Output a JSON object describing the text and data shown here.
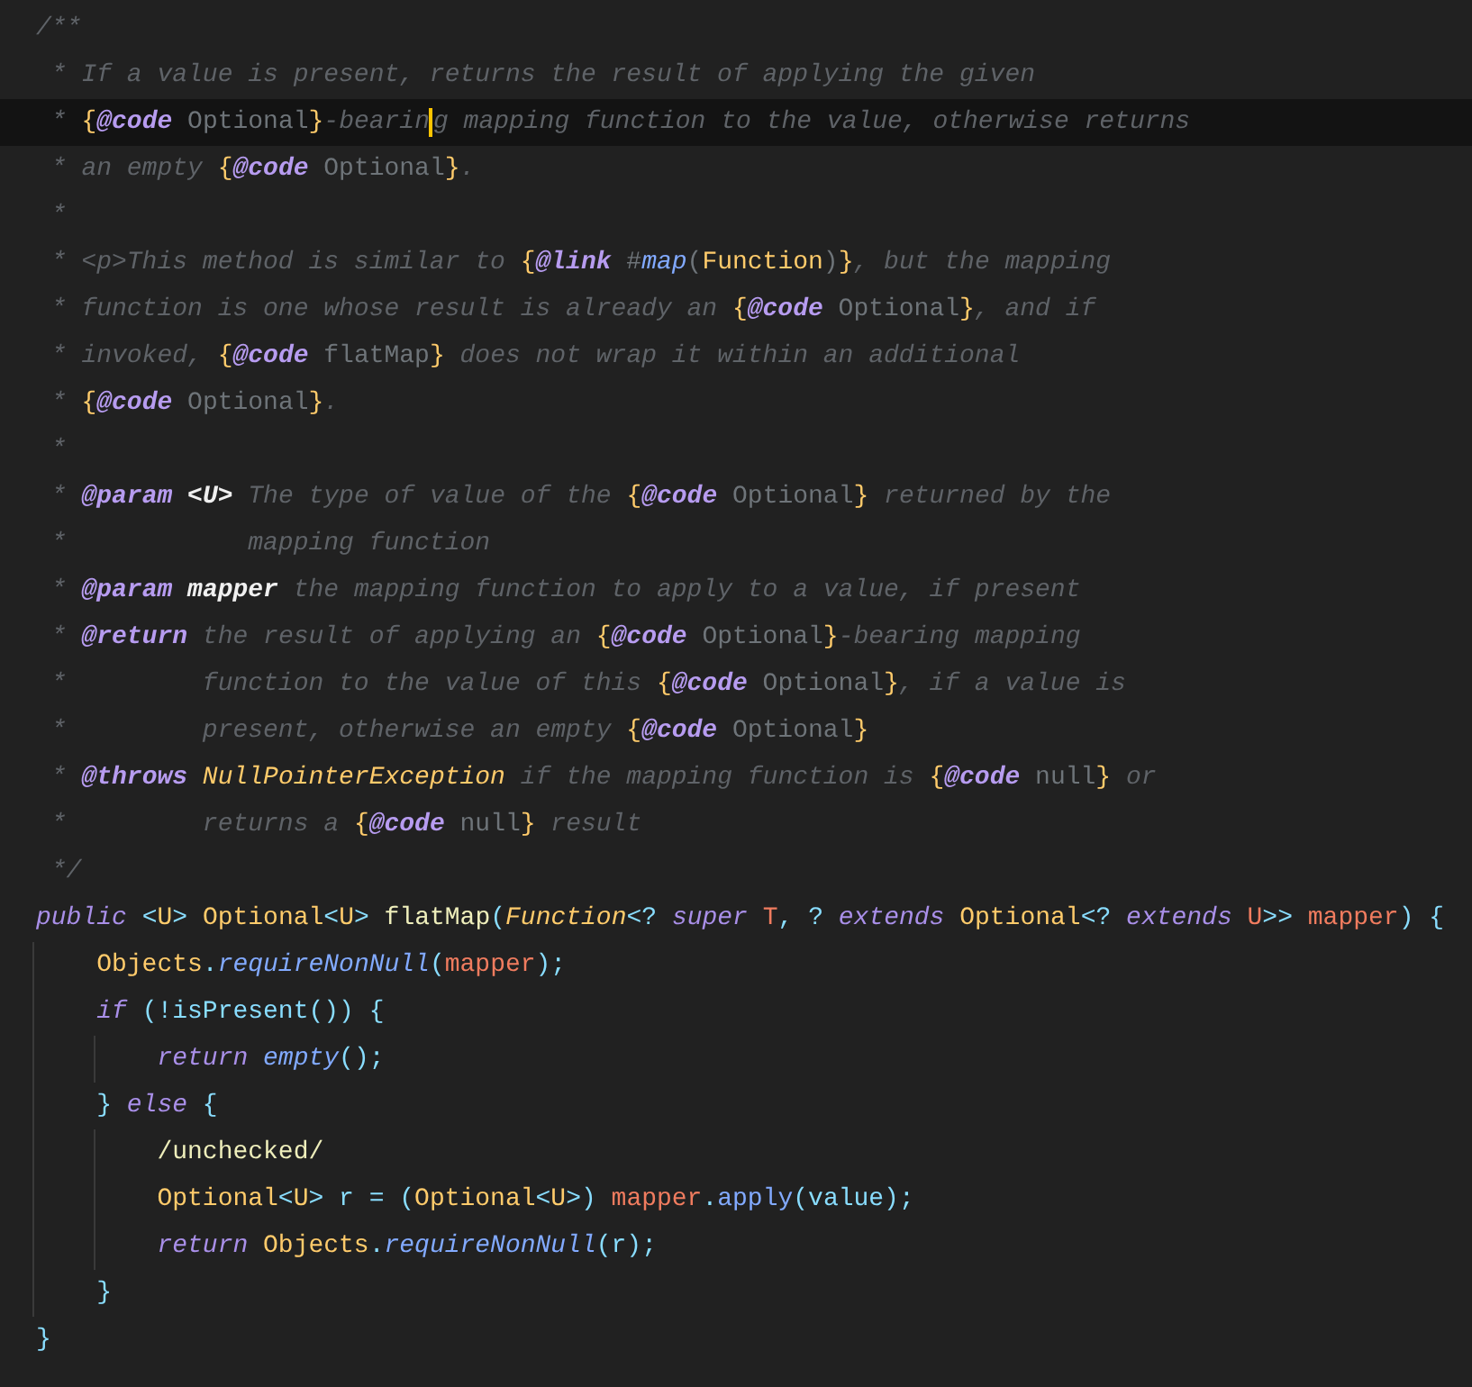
{
  "editor": {
    "lines": [
      {
        "current": false,
        "tokens": [
          {
            "text": "/**",
            "kind": "c"
          }
        ]
      },
      {
        "current": false,
        "tokens": [
          {
            "text": " * If a value is present, returns the result of applying the given",
            "kind": "c"
          }
        ]
      },
      {
        "current": true,
        "tokens": [
          {
            "text": " * ",
            "kind": "c"
          },
          {
            "text": "{",
            "kind": "br"
          },
          {
            "text": "@code",
            "kind": "tag"
          },
          {
            "text": " Optional",
            "kind": "ct"
          },
          {
            "text": "}",
            "kind": "br"
          },
          {
            "text": "-bearin",
            "kind": "c"
          },
          {
            "text": "g mapping function to the value, otherwise returns",
            "kind": "c",
            "cursor": true
          }
        ]
      },
      {
        "current": false,
        "tokens": [
          {
            "text": " * an empty ",
            "kind": "c"
          },
          {
            "text": "{",
            "kind": "br"
          },
          {
            "text": "@code",
            "kind": "tag"
          },
          {
            "text": " Optional",
            "kind": "ct"
          },
          {
            "text": "}",
            "kind": "br"
          },
          {
            "text": ".",
            "kind": "c"
          }
        ]
      },
      {
        "current": false,
        "tokens": [
          {
            "text": " *",
            "kind": "c"
          }
        ]
      },
      {
        "current": false,
        "tokens": [
          {
            "text": " * <p>This method is similar to ",
            "kind": "c"
          },
          {
            "text": "{",
            "kind": "br"
          },
          {
            "text": "@link",
            "kind": "tag"
          },
          {
            "text": " #",
            "kind": "ct"
          },
          {
            "text": "map",
            "kind": "mi"
          },
          {
            "text": "(",
            "kind": "ct"
          },
          {
            "text": "Function",
            "kind": "ty"
          },
          {
            "text": ")",
            "kind": "ct"
          },
          {
            "text": "}",
            "kind": "br"
          },
          {
            "text": ", but the mapping",
            "kind": "c"
          }
        ]
      },
      {
        "current": false,
        "tokens": [
          {
            "text": " * function is one whose result is already an ",
            "kind": "c"
          },
          {
            "text": "{",
            "kind": "br"
          },
          {
            "text": "@code",
            "kind": "tag"
          },
          {
            "text": " Optional",
            "kind": "ct"
          },
          {
            "text": "}",
            "kind": "br"
          },
          {
            "text": ", and if",
            "kind": "c"
          }
        ]
      },
      {
        "current": false,
        "tokens": [
          {
            "text": " * invoked, ",
            "kind": "c"
          },
          {
            "text": "{",
            "kind": "br"
          },
          {
            "text": "@code",
            "kind": "tag"
          },
          {
            "text": " flatMap",
            "kind": "ct"
          },
          {
            "text": "}",
            "kind": "br"
          },
          {
            "text": " does not wrap it within an additional",
            "kind": "c"
          }
        ]
      },
      {
        "current": false,
        "tokens": [
          {
            "text": " * ",
            "kind": "c"
          },
          {
            "text": "{",
            "kind": "br"
          },
          {
            "text": "@code",
            "kind": "tag"
          },
          {
            "text": " Optional",
            "kind": "ct"
          },
          {
            "text": "}",
            "kind": "br"
          },
          {
            "text": ".",
            "kind": "c"
          }
        ]
      },
      {
        "current": false,
        "tokens": [
          {
            "text": " *",
            "kind": "c"
          }
        ]
      },
      {
        "current": false,
        "tokens": [
          {
            "text": " * ",
            "kind": "c"
          },
          {
            "text": "@param",
            "kind": "tag"
          },
          {
            "text": " <U>",
            "kind": "pn"
          },
          {
            "text": " The type of value of the ",
            "kind": "c"
          },
          {
            "text": "{",
            "kind": "br"
          },
          {
            "text": "@code",
            "kind": "tag"
          },
          {
            "text": " Optional",
            "kind": "ct"
          },
          {
            "text": "}",
            "kind": "br"
          },
          {
            "text": " returned by the",
            "kind": "c"
          }
        ]
      },
      {
        "current": false,
        "tokens": [
          {
            "text": " *            mapping function",
            "kind": "c"
          }
        ]
      },
      {
        "current": false,
        "tokens": [
          {
            "text": " * ",
            "kind": "c"
          },
          {
            "text": "@param",
            "kind": "tag"
          },
          {
            "text": " mapper",
            "kind": "pn"
          },
          {
            "text": " the mapping function to apply to a value, if present",
            "kind": "c"
          }
        ]
      },
      {
        "current": false,
        "tokens": [
          {
            "text": " * ",
            "kind": "c"
          },
          {
            "text": "@return",
            "kind": "tag"
          },
          {
            "text": " the result of applying an ",
            "kind": "c"
          },
          {
            "text": "{",
            "kind": "br"
          },
          {
            "text": "@code",
            "kind": "tag"
          },
          {
            "text": " Optional",
            "kind": "ct"
          },
          {
            "text": "}",
            "kind": "br"
          },
          {
            "text": "-bearing mapping",
            "kind": "c"
          }
        ]
      },
      {
        "current": false,
        "tokens": [
          {
            "text": " *         function to the value of this ",
            "kind": "c"
          },
          {
            "text": "{",
            "kind": "br"
          },
          {
            "text": "@code",
            "kind": "tag"
          },
          {
            "text": " Optional",
            "kind": "ct"
          },
          {
            "text": "}",
            "kind": "br"
          },
          {
            "text": ", if a value is",
            "kind": "c"
          }
        ]
      },
      {
        "current": false,
        "tokens": [
          {
            "text": " *         present, otherwise an empty ",
            "kind": "c"
          },
          {
            "text": "{",
            "kind": "br"
          },
          {
            "text": "@code",
            "kind": "tag"
          },
          {
            "text": " Optional",
            "kind": "ct"
          },
          {
            "text": "}",
            "kind": "br"
          }
        ]
      },
      {
        "current": false,
        "tokens": [
          {
            "text": " * ",
            "kind": "c"
          },
          {
            "text": "@throws",
            "kind": "tag"
          },
          {
            "text": " NullPointerException",
            "kind": "ex"
          },
          {
            "text": " if the mapping function is ",
            "kind": "c"
          },
          {
            "text": "{",
            "kind": "br"
          },
          {
            "text": "@code",
            "kind": "tag"
          },
          {
            "text": " null",
            "kind": "ct"
          },
          {
            "text": "}",
            "kind": "br"
          },
          {
            "text": " or",
            "kind": "c"
          }
        ]
      },
      {
        "current": false,
        "tokens": [
          {
            "text": " *         returns a ",
            "kind": "c"
          },
          {
            "text": "{",
            "kind": "br"
          },
          {
            "text": "@code",
            "kind": "tag"
          },
          {
            "text": " null",
            "kind": "ct"
          },
          {
            "text": "}",
            "kind": "br"
          },
          {
            "text": " result",
            "kind": "c"
          }
        ]
      },
      {
        "current": false,
        "tokens": [
          {
            "text": " */",
            "kind": "c"
          }
        ]
      },
      {
        "current": false,
        "tokens": [
          {
            "text": "public",
            "kind": "kw"
          },
          {
            "text": " <",
            "kind": "p"
          },
          {
            "text": "U",
            "kind": "ty"
          },
          {
            "text": "> ",
            "kind": "p"
          },
          {
            "text": "Optional",
            "kind": "ty"
          },
          {
            "text": "<",
            "kind": "p"
          },
          {
            "text": "U",
            "kind": "ty"
          },
          {
            "text": "> ",
            "kind": "p"
          },
          {
            "text": "flatMap",
            "kind": "fn"
          },
          {
            "text": "(",
            "kind": "p"
          },
          {
            "text": "Function",
            "kind": "ti"
          },
          {
            "text": "<? ",
            "kind": "p"
          },
          {
            "text": "super",
            "kind": "kw"
          },
          {
            "text": " T",
            "kind": "pa"
          },
          {
            "text": ", ? ",
            "kind": "p"
          },
          {
            "text": "extends",
            "kind": "kw"
          },
          {
            "text": " Optional",
            "kind": "ty"
          },
          {
            "text": "<? ",
            "kind": "p"
          },
          {
            "text": "extends",
            "kind": "kw"
          },
          {
            "text": " U",
            "kind": "pa"
          },
          {
            "text": ">> ",
            "kind": "p"
          },
          {
            "text": "mapper",
            "kind": "pa"
          },
          {
            "text": ") {",
            "kind": "p"
          }
        ]
      },
      {
        "current": false,
        "tokens": [
          {
            "text": "    Objects",
            "kind": "ty"
          },
          {
            "text": ".",
            "kind": "p"
          },
          {
            "text": "requireNonNull",
            "kind": "mi"
          },
          {
            "text": "(",
            "kind": "p"
          },
          {
            "text": "mapper",
            "kind": "pa"
          },
          {
            "text": ");",
            "kind": "p"
          }
        ]
      },
      {
        "current": false,
        "tokens": [
          {
            "text": "    if",
            "kind": "kw"
          },
          {
            "text": " (!isPresent()) {",
            "kind": "p"
          }
        ]
      },
      {
        "current": false,
        "tokens": [
          {
            "text": "        return",
            "kind": "kw"
          },
          {
            "text": " empty",
            "kind": "mi"
          },
          {
            "text": "();",
            "kind": "p"
          }
        ]
      },
      {
        "current": false,
        "tokens": [
          {
            "text": "    } ",
            "kind": "p"
          },
          {
            "text": "else",
            "kind": "kw"
          },
          {
            "text": " {",
            "kind": "p"
          }
        ]
      },
      {
        "current": false,
        "tokens": [
          {
            "text": "        /unchecked/",
            "kind": "fn"
          }
        ]
      },
      {
        "current": false,
        "tokens": [
          {
            "text": "        Optional",
            "kind": "ty"
          },
          {
            "text": "<",
            "kind": "p"
          },
          {
            "text": "U",
            "kind": "ty"
          },
          {
            "text": "> r = (",
            "kind": "p"
          },
          {
            "text": "Optional",
            "kind": "ty"
          },
          {
            "text": "<",
            "kind": "p"
          },
          {
            "text": "U",
            "kind": "ty"
          },
          {
            "text": ">) ",
            "kind": "p"
          },
          {
            "text": "mapper",
            "kind": "pa"
          },
          {
            "text": ".",
            "kind": "p"
          },
          {
            "text": "apply",
            "kind": "m"
          },
          {
            "text": "(value);",
            "kind": "p"
          }
        ]
      },
      {
        "current": false,
        "tokens": [
          {
            "text": "        return",
            "kind": "kw"
          },
          {
            "text": " Objects",
            "kind": "ty"
          },
          {
            "text": ".",
            "kind": "p"
          },
          {
            "text": "requireNonNull",
            "kind": "mi"
          },
          {
            "text": "(r);",
            "kind": "p"
          }
        ]
      },
      {
        "current": false,
        "tokens": [
          {
            "text": "    }",
            "kind": "p"
          }
        ]
      },
      {
        "current": false,
        "tokens": [
          {
            "text": "}",
            "kind": "p"
          }
        ]
      }
    ]
  }
}
